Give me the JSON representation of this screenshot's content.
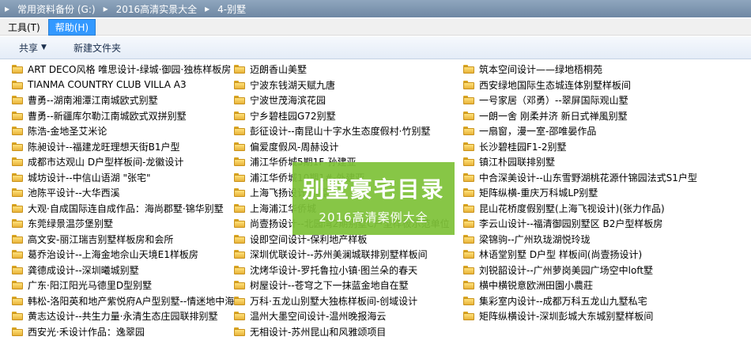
{
  "address": {
    "segments": [
      "常用资料备份 (G:)",
      "2016高清实景大全",
      "4-别墅"
    ]
  },
  "menu": {
    "items": [
      {
        "label": "工具(T)",
        "active": false
      },
      {
        "label": "帮助(H)",
        "active": true
      }
    ]
  },
  "toolbar": {
    "share_label": "共享",
    "new_folder_label": "新建文件夹"
  },
  "files": {
    "col1": [
      "ART DECO风格 唯思设计-绿城·御园·独栋样板房",
      "TIANMA COUNTRY CLUB VILLA A3",
      "曹勇--湖南湘潭江南城欧式别墅",
      "曹勇--新疆库尔勒江南城欧式双拼别墅",
      "陈浩-金地圣艾米论",
      "陈昶设计--福建龙旺理想天街B1户型",
      "成都市达观山 D户型样板间-龙徽设计",
      "城坊设计--中信山语湖 \"张宅\"",
      "池陈平设计--大华西溪",
      "大观·自成国际连自成作品：海尚郡墅·锦华别墅",
      "东莞绿景温莎堡别墅",
      "高文安-丽江瑞吉别墅样板房和会所",
      "葛乔治设计--上海金地佘山天境E1样板房",
      "龚德成设计--深圳曦城别墅",
      "广东·阳江阳光马德里D型别墅",
      "韩松-洛阳英和地产紫悦府A户型别墅--情迷地中海",
      "黄志达设计--共生力量·永清生态庄园联排别墅",
      "西安光·禾设计作品：逸翠园"
    ],
    "col2": [
      "迈朗香山美墅",
      "宁波东钱湖天赋九唐",
      "宁波世茂海滨花园",
      "宁乡碧桂园G72别墅",
      "彭征设计--南昆山十字水生态度假村·竹别墅",
      "偏爱度假风-周赫设计",
      "浦江华侨城5期1F-孙建亚",
      "浦江华侨城10期1#-外建亚",
      "上海飞扬设计-别墅",
      "上海浦江华侨城",
      "尚壹扬设计--北园湾2期别墅C户型样板示范单位",
      "设即空间设计-保利地产样板",
      "深圳优联设计--苏州美澜城联排别墅样板间",
      "沈烤华设计-罗托鲁拉小镇·图兰朵的春天",
      "树屋设计--苍穹之下一抹蓝金地自在墅",
      "万科·五龙山别墅大独栋样板间-创域设计",
      "温州大墨空间设计-温州晚报海云",
      "无相设计-苏州昆山和风雅颂项目"
    ],
    "col3": [
      "筑本空间设计——绿地梧桐苑",
      "西安绿地国际生态城连体别墅样板间",
      "一号家居（邓勇）--翠屏国际观山墅",
      "一朗一舍 刚柔并济 新日式禅風别墅",
      "一扇窗，漫一室-邵唯晏作品",
      "长沙碧桂园F1-2别墅",
      "镇江朴园联排别墅",
      "中合深美设计--山东雪野湖桃花源什锦园法式S1户型",
      "矩阵纵横-重庆万科城LP别墅",
      "昆山花桥度假别墅(上海飞视设计)(张力作品)",
      "李云山设计--福清御园别墅区 B2户型样板房",
      "梁锦驹--广州玖珑湖悦玲珑",
      "林语堂别墅 D户型 样板间(尚壹扬设计)",
      "刘锐韶设计--广州萝岗美园广场空中loft墅",
      "横中横锐意欧洲田園小農莊",
      "集彩室内设计--成都万科五龙山九墅私宅",
      "矩阵纵横设计-深圳彭城大东城别墅样板间"
    ]
  },
  "banner": {
    "title": "别墅豪宅目录",
    "subtitle": "2016高清案例大全"
  },
  "colors": {
    "address_bar": "#7b93ad",
    "banner_green": "#7ec238",
    "menu_active": "#3399ff"
  }
}
